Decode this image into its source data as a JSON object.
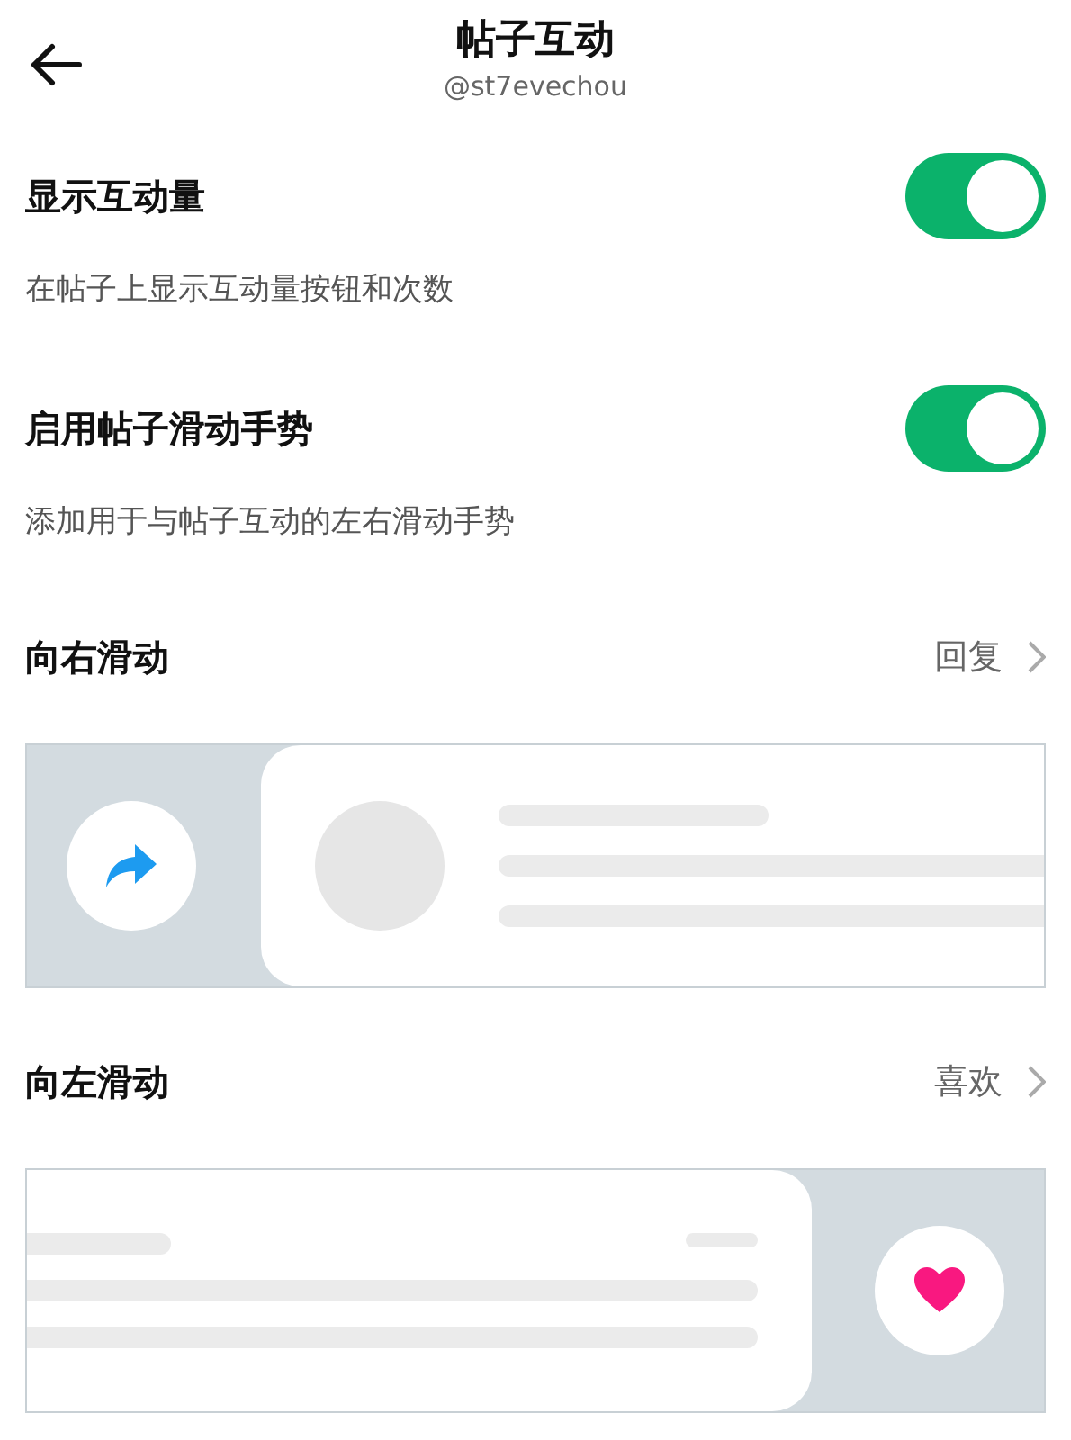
{
  "header": {
    "title": "帖子互动",
    "subtitle": "@st7evechou"
  },
  "sections": [
    {
      "kind": "toggle",
      "label": "显示互动量",
      "description": "在帖子上显示互动量按钮和次数",
      "on": true
    },
    {
      "kind": "toggle",
      "label": "启用帖子滑动手势",
      "description": "添加用于与帖子互动的左右滑动手势",
      "on": true
    },
    {
      "kind": "swipe_right",
      "label": "向右滑动",
      "value": "回复"
    },
    {
      "kind": "swipe_left",
      "label": "向左滑动",
      "value": "喜欢"
    }
  ]
}
